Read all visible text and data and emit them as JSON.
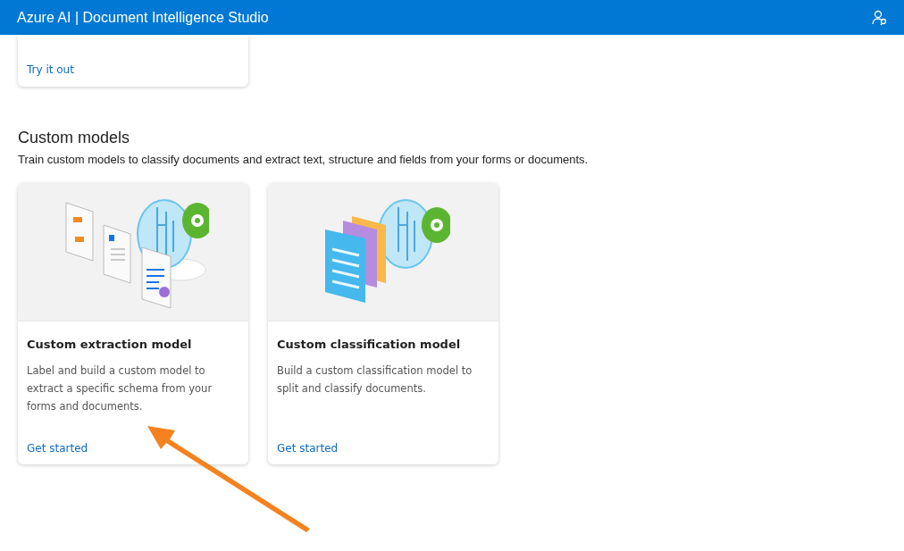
{
  "header": {
    "title": "Azure AI | Document Intelligence Studio"
  },
  "previous_card": {
    "link": "Try it out"
  },
  "section": {
    "title": "Custom models",
    "description": "Train custom models to classify documents and extract text, structure and fields from your forms or documents."
  },
  "cards": [
    {
      "kind": "extraction",
      "title": "Custom extraction model",
      "description": "Label and build a custom model to extract a specific schema from your forms and documents.",
      "link": "Get started"
    },
    {
      "kind": "classification",
      "title": "Custom classification model",
      "description": "Build a custom classification model to split and classify documents.",
      "link": "Get started"
    }
  ]
}
